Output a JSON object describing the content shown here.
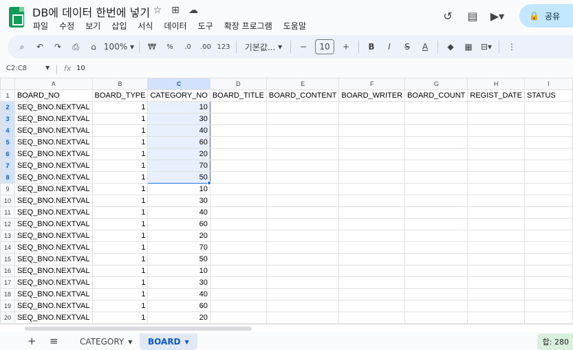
{
  "title": {
    "doc_name": "DB에 데이터 한번에 넣기",
    "menu": [
      "파일",
      "수정",
      "보기",
      "삽입",
      "서식",
      "데이터",
      "도구",
      "확장 프로그램",
      "도움말"
    ],
    "share_label": "공유"
  },
  "toolbar": {
    "zoom": "100%",
    "currency": "₩",
    "percent": "%",
    "dec_less": ".0",
    "dec_more": ".00",
    "number_format": "123",
    "font": "기본값...",
    "font_size": "10"
  },
  "formula_bar": {
    "name_box": "C2:C8",
    "fx": "fx",
    "value": "10"
  },
  "grid": {
    "columns": [
      "A",
      "B",
      "C",
      "D",
      "E",
      "F",
      "G",
      "H",
      "I"
    ],
    "selected_column": "C",
    "selected_rows": [
      2,
      3,
      4,
      5,
      6,
      7,
      8
    ],
    "header_row": [
      "BOARD_NO",
      "BOARD_TYPE",
      "CATEGORY_NO",
      "BOARD_TITLE",
      "BOARD_CONTENT",
      "BOARD_WRITER",
      "BOARD_COUNT",
      "REGIST_DATE",
      "STATUS"
    ],
    "rows": [
      {
        "n": "2",
        "a": "SEQ_BNO.NEXTVAL",
        "b": "1",
        "c": "10"
      },
      {
        "n": "3",
        "a": "SEQ_BNO.NEXTVAL",
        "b": "1",
        "c": "30"
      },
      {
        "n": "4",
        "a": "SEQ_BNO.NEXTVAL",
        "b": "1",
        "c": "40"
      },
      {
        "n": "5",
        "a": "SEQ_BNO.NEXTVAL",
        "b": "1",
        "c": "60"
      },
      {
        "n": "6",
        "a": "SEQ_BNO.NEXTVAL",
        "b": "1",
        "c": "20"
      },
      {
        "n": "7",
        "a": "SEQ_BNO.NEXTVAL",
        "b": "1",
        "c": "70"
      },
      {
        "n": "8",
        "a": "SEQ_BNO.NEXTVAL",
        "b": "1",
        "c": "50"
      },
      {
        "n": "9",
        "a": "SEQ_BNO.NEXTVAL",
        "b": "1",
        "c": "10"
      },
      {
        "n": "10",
        "a": "SEQ_BNO.NEXTVAL",
        "b": "1",
        "c": "30"
      },
      {
        "n": "11",
        "a": "SEQ_BNO.NEXTVAL",
        "b": "1",
        "c": "40"
      },
      {
        "n": "12",
        "a": "SEQ_BNO.NEXTVAL",
        "b": "1",
        "c": "60"
      },
      {
        "n": "13",
        "a": "SEQ_BNO.NEXTVAL",
        "b": "1",
        "c": "20"
      },
      {
        "n": "14",
        "a": "SEQ_BNO.NEXTVAL",
        "b": "1",
        "c": "70"
      },
      {
        "n": "15",
        "a": "SEQ_BNO.NEXTVAL",
        "b": "1",
        "c": "50"
      },
      {
        "n": "16",
        "a": "SEQ_BNO.NEXTVAL",
        "b": "1",
        "c": "10"
      },
      {
        "n": "17",
        "a": "SEQ_BNO.NEXTVAL",
        "b": "1",
        "c": "30"
      },
      {
        "n": "18",
        "a": "SEQ_BNO.NEXTVAL",
        "b": "1",
        "c": "40"
      },
      {
        "n": "19",
        "a": "SEQ_BNO.NEXTVAL",
        "b": "1",
        "c": "60"
      },
      {
        "n": "20",
        "a": "SEQ_BNO.NEXTVAL",
        "b": "1",
        "c": "20"
      }
    ]
  },
  "sheets": {
    "tabs": [
      "CATEGORY",
      "BOARD"
    ],
    "active": "BOARD",
    "sum_label": "합: 280"
  },
  "colors": {
    "selection_border": "#1a73e8",
    "selection_fill": "#e8f0fe",
    "share_bg": "#c2e7ff",
    "sheets_green": "#0f9d58"
  }
}
